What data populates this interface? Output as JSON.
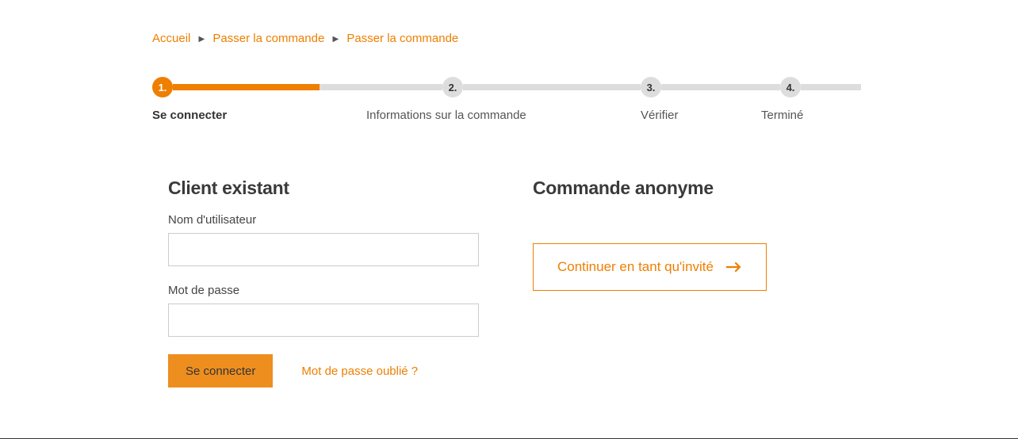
{
  "breadcrumb": {
    "items": [
      {
        "label": "Accueil",
        "link": true
      },
      {
        "label": "Passer la commande",
        "link": true
      },
      {
        "label": "Passer la commande",
        "link": true
      }
    ]
  },
  "steps": [
    {
      "num": "1.",
      "label": "Se connecter",
      "active": true
    },
    {
      "num": "2.",
      "label": "Informations sur la commande",
      "active": false
    },
    {
      "num": "3.",
      "label": "Vérifier",
      "active": false
    },
    {
      "num": "4.",
      "label": "Terminé",
      "active": false
    }
  ],
  "login": {
    "heading": "Client existant",
    "username_label": "Nom d'utilisateur",
    "username_value": "",
    "password_label": "Mot de passe",
    "password_value": "",
    "submit_label": "Se connecter",
    "forgot_label": "Mot de passe oublié ?"
  },
  "guest": {
    "heading": "Commande anonyme",
    "button_label": "Continuer en tant qu'invité"
  },
  "colors": {
    "accent": "#ee7f00"
  }
}
